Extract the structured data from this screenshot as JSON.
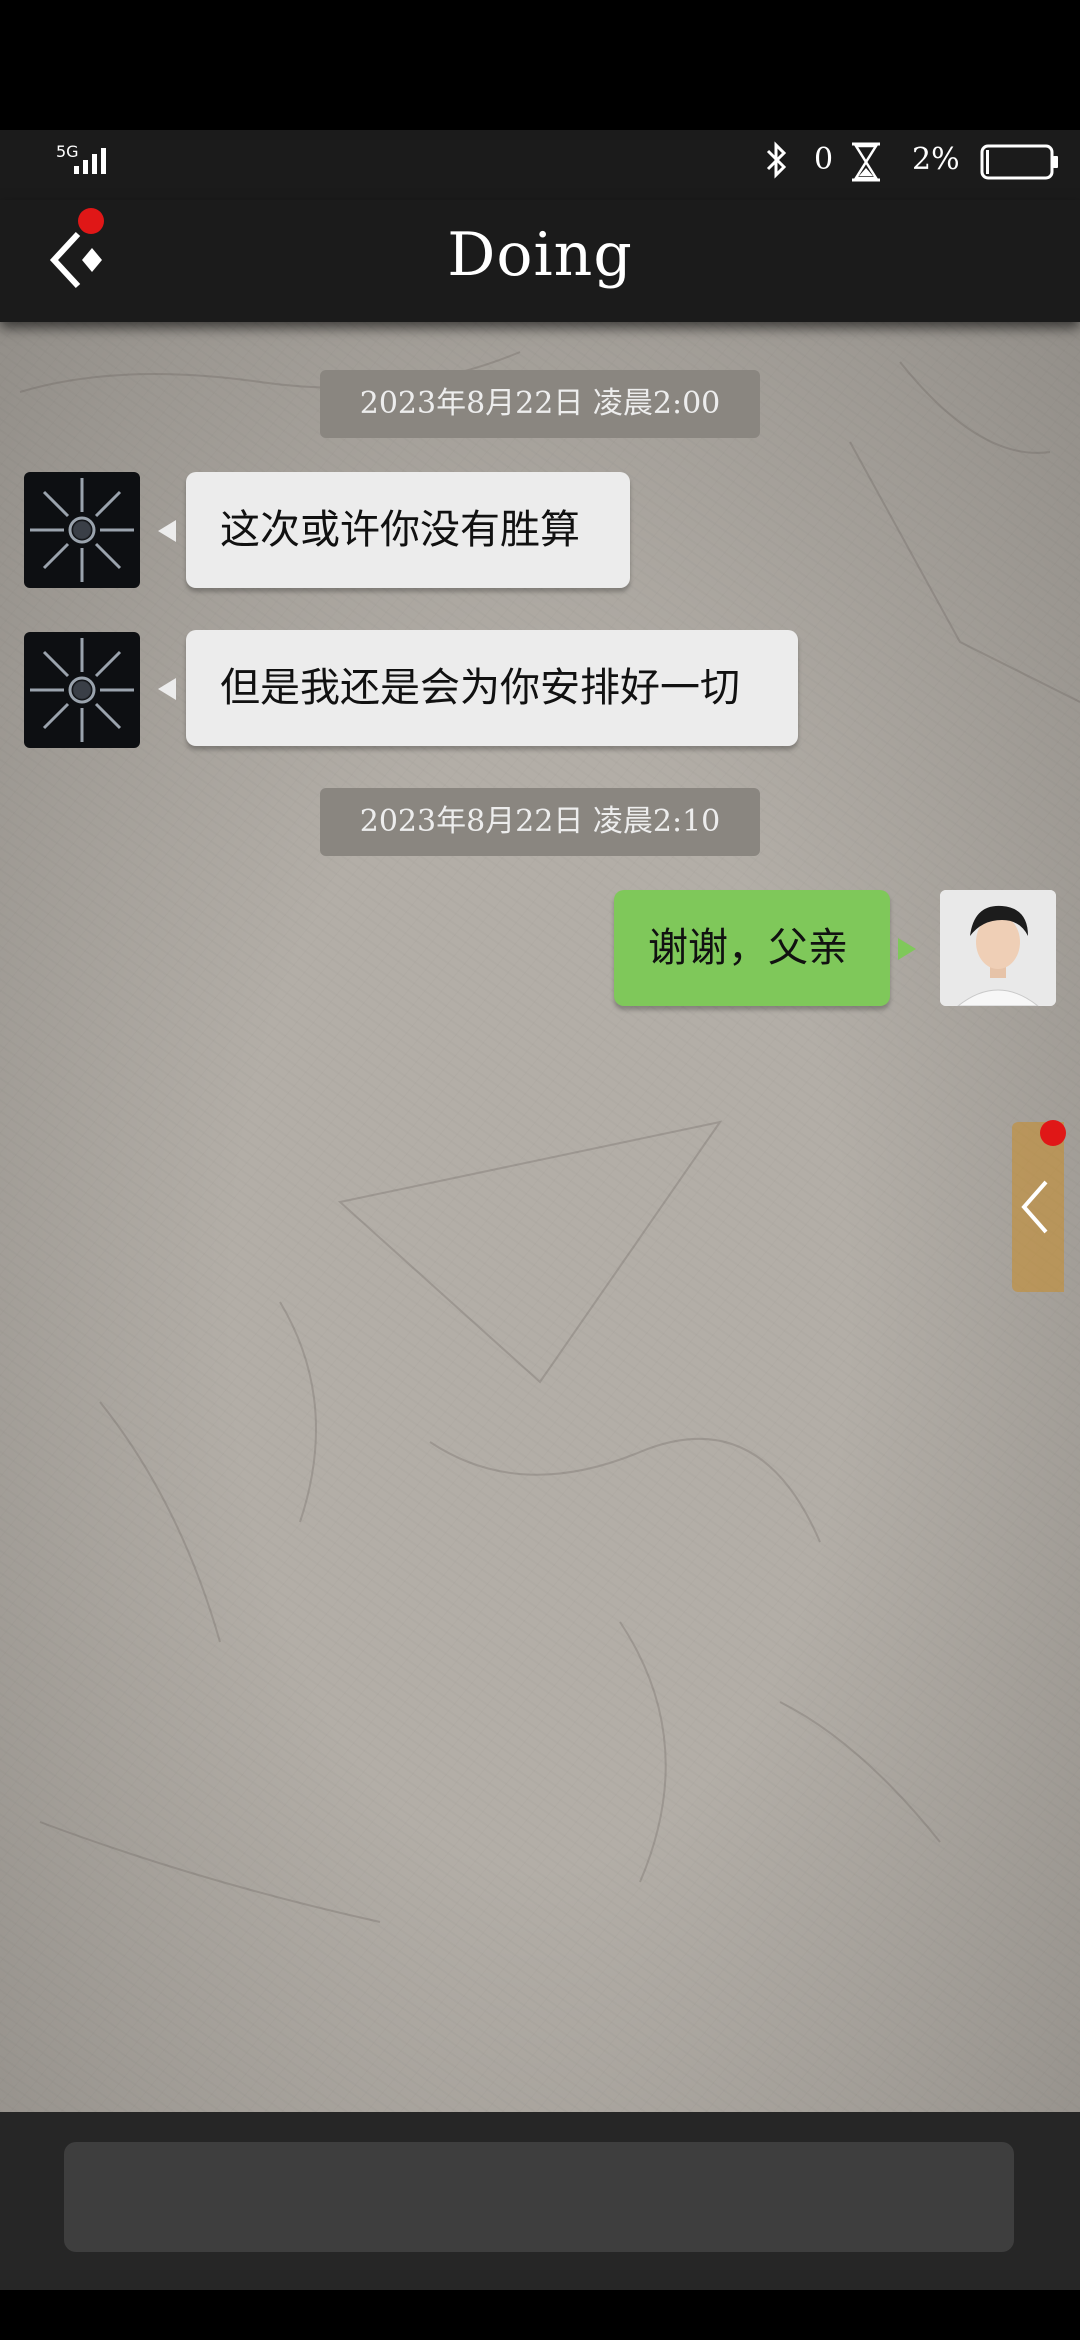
{
  "status_bar": {
    "network": "5G",
    "bluetooth_count": "0",
    "battery_percent": "2%",
    "icons": [
      "signal-icon",
      "bluetooth-icon",
      "hourglass-icon",
      "battery-icon"
    ]
  },
  "header": {
    "title": "Doing",
    "back_icon": "back-arrow-icon"
  },
  "chat": {
    "messages": [
      {
        "type": "timestamp",
        "text": "2023年8月22日 凌晨2:00"
      },
      {
        "type": "incoming",
        "text": "这次或许你没有胜算"
      },
      {
        "type": "incoming",
        "text": "但是我还是会为你安排好一切"
      },
      {
        "type": "timestamp",
        "text": "2023年8月22日 凌晨2:10"
      },
      {
        "type": "outgoing",
        "text": "谢谢，父亲"
      }
    ]
  },
  "side_panel": {
    "icon": "chevron-left-icon"
  },
  "input": {
    "value": "",
    "placeholder": ""
  },
  "colors": {
    "header_bg": "#1b1b1b",
    "chat_bg": "#b3aea7",
    "incoming_bubble": "#ececec",
    "outgoing_bubble": "#7fc85a",
    "timestamp_bg": "#8a8680",
    "notification_dot": "#e01717"
  }
}
